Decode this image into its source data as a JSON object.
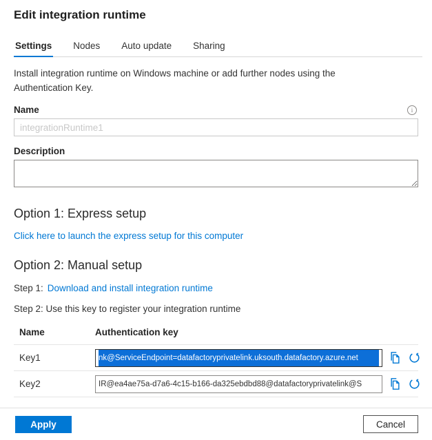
{
  "header": {
    "title": "Edit integration runtime"
  },
  "tabs": [
    {
      "label": "Settings",
      "active": true
    },
    {
      "label": "Nodes",
      "active": false
    },
    {
      "label": "Auto update",
      "active": false
    },
    {
      "label": "Sharing",
      "active": false
    }
  ],
  "settings": {
    "intro": "Install integration runtime on Windows machine or add further nodes using the Authentication Key.",
    "name_label": "Name",
    "name_value": "integrationRuntime1",
    "info_glyph": "i",
    "description_label": "Description",
    "description_value": "",
    "option1_heading": "Option 1: Express setup",
    "express_link": "Click here to launch the express setup for this computer",
    "option2_heading": "Option 2: Manual setup",
    "step1_prefix": "Step 1:",
    "step1_link": "Download and install integration runtime",
    "step2_text": "Step 2: Use this key to register your integration runtime"
  },
  "keys_table": {
    "columns": [
      "Name",
      "Authentication key"
    ],
    "rows": [
      {
        "name": "Key1",
        "value": "nk@ServiceEndpoint=datafactoryprivatelink.uksouth.datafactory.azure.net",
        "selected": true
      },
      {
        "name": "Key2",
        "value": "IR@ea4ae75a-d7a6-4c15-b166-da325ebdbd88@datafactoryprivatelink@S",
        "selected": false
      }
    ]
  },
  "footer": {
    "apply_label": "Apply",
    "cancel_label": "Cancel"
  },
  "colors": {
    "accent": "#0078d4",
    "selection_background": "#0d6fd8",
    "selection_text": "#ffffff",
    "divider": "#e5e5e5",
    "disabled_text": "#c8c8c8"
  }
}
